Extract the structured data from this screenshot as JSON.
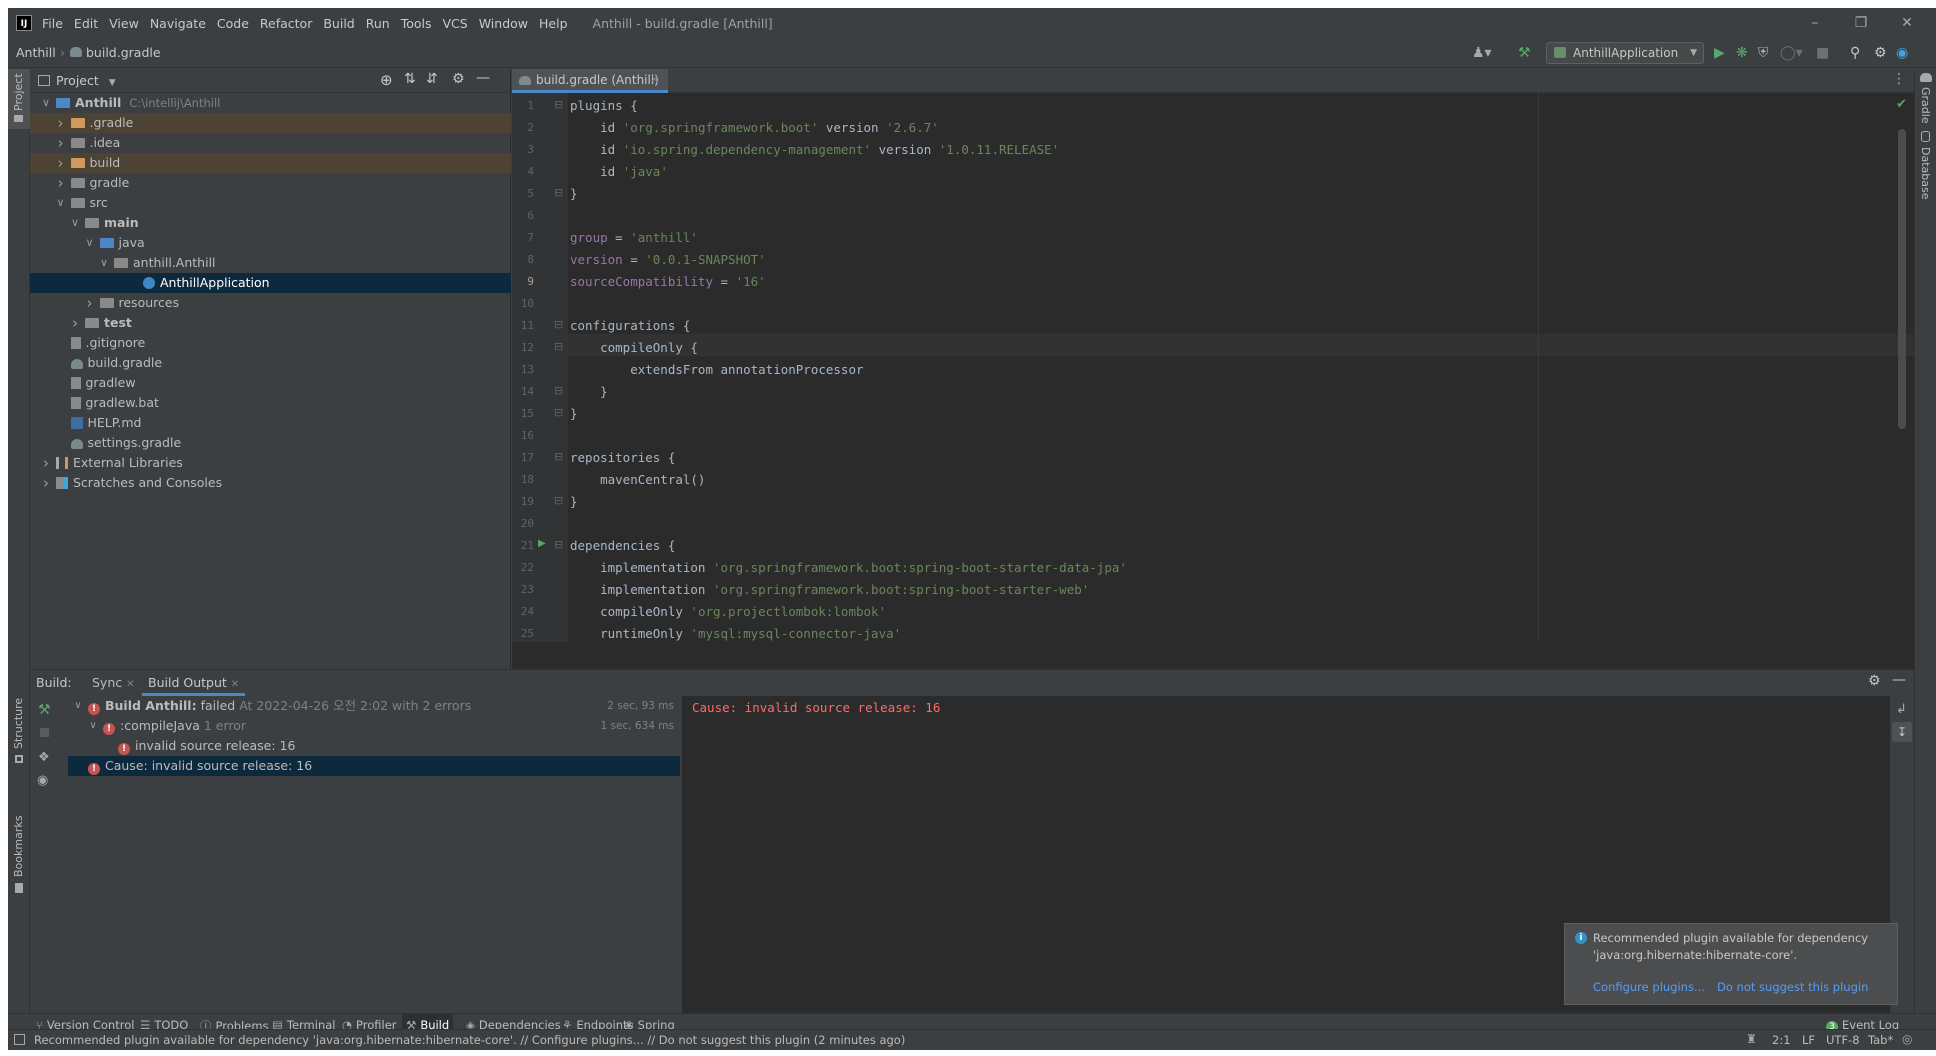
{
  "titlebar": {
    "logo": "IJ",
    "menu": [
      "File",
      "Edit",
      "View",
      "Navigate",
      "Code",
      "Refactor",
      "Build",
      "Run",
      "Tools",
      "VCS",
      "Window",
      "Help"
    ],
    "title": "Anthill - build.gradle [Anthill]"
  },
  "navbar": {
    "project": "Anthill",
    "file": "build.gradle",
    "run_config": "AnthillApplication"
  },
  "left_stripe": {
    "project": "Project",
    "structure": "Structure",
    "bookmarks": "Bookmarks"
  },
  "right_stripe": {
    "gradle": "Gradle",
    "database": "Database"
  },
  "project_panel": {
    "title": "Project",
    "tree": [
      {
        "label": "Anthill",
        "extra": "C:\\intellij\\Anthill",
        "depth": 0,
        "arrow": "down",
        "icon": "module",
        "bold": true
      },
      {
        "label": ".gradle",
        "depth": 1,
        "arrow": "right",
        "icon": "orange",
        "excluded": true
      },
      {
        "label": ".idea",
        "depth": 1,
        "arrow": "right",
        "icon": "gray"
      },
      {
        "label": "build",
        "depth": 1,
        "arrow": "right",
        "icon": "orange",
        "excluded": true
      },
      {
        "label": "gradle",
        "depth": 1,
        "arrow": "right",
        "icon": "gray"
      },
      {
        "label": "src",
        "depth": 1,
        "arrow": "down",
        "icon": "gray"
      },
      {
        "label": "main",
        "depth": 2,
        "arrow": "down",
        "icon": "gray",
        "bold": true
      },
      {
        "label": "java",
        "depth": 3,
        "arrow": "down",
        "icon": "blue"
      },
      {
        "label": "anthill.Anthill",
        "depth": 4,
        "arrow": "down",
        "icon": "gray"
      },
      {
        "label": "AnthillApplication",
        "depth": 6,
        "arrow": "",
        "icon": "class",
        "selected": true
      },
      {
        "label": "resources",
        "depth": 3,
        "arrow": "right",
        "icon": "gray"
      },
      {
        "label": "test",
        "depth": 2,
        "arrow": "right",
        "icon": "gray",
        "bold": true
      },
      {
        "label": ".gitignore",
        "depth": 1,
        "arrow": "",
        "icon": "file"
      },
      {
        "label": "build.gradle",
        "depth": 1,
        "arrow": "",
        "icon": "gradle"
      },
      {
        "label": "gradlew",
        "depth": 1,
        "arrow": "",
        "icon": "file"
      },
      {
        "label": "gradlew.bat",
        "depth": 1,
        "arrow": "",
        "icon": "file"
      },
      {
        "label": "HELP.md",
        "depth": 1,
        "arrow": "",
        "icon": "md"
      },
      {
        "label": "settings.gradle",
        "depth": 1,
        "arrow": "",
        "icon": "gradle"
      },
      {
        "label": "External Libraries",
        "depth": 0,
        "arrow": "right",
        "icon": "lib"
      },
      {
        "label": "Scratches and Consoles",
        "depth": 0,
        "arrow": "right",
        "icon": "scratch"
      }
    ]
  },
  "editor": {
    "tab_label": "build.gradle (Anthill)",
    "current_line": 9,
    "lines": [
      [
        {
          "t": "plugins {",
          "c": "kw"
        }
      ],
      [
        {
          "t": "    id ",
          "c": "kw"
        },
        {
          "t": "'org.springframework.boot'",
          "c": "str"
        },
        {
          "t": " version ",
          "c": "kw"
        },
        {
          "t": "'2.6.7'",
          "c": "str"
        }
      ],
      [
        {
          "t": "    id ",
          "c": "kw"
        },
        {
          "t": "'io.spring.dependency-management'",
          "c": "str"
        },
        {
          "t": " version ",
          "c": "kw"
        },
        {
          "t": "'1.0.11.RELEASE'",
          "c": "str"
        }
      ],
      [
        {
          "t": "    id ",
          "c": "kw"
        },
        {
          "t": "'java'",
          "c": "str"
        }
      ],
      [
        {
          "t": "}",
          "c": "kw"
        }
      ],
      [],
      [
        {
          "t": "group",
          "c": "prop"
        },
        {
          "t": " = ",
          "c": "kw"
        },
        {
          "t": "'anthill'",
          "c": "str"
        }
      ],
      [
        {
          "t": "version",
          "c": "prop"
        },
        {
          "t": " = ",
          "c": "kw"
        },
        {
          "t": "'0.0.1-SNAPSHOT'",
          "c": "str"
        }
      ],
      [
        {
          "t": "sourceCompatibility",
          "c": "prop"
        },
        {
          "t": " = ",
          "c": "kw"
        },
        {
          "t": "'16'",
          "c": "str"
        }
      ],
      [],
      [
        {
          "t": "configurations {",
          "c": "kw"
        }
      ],
      [
        {
          "t": "    compileOnly {",
          "c": "kw"
        }
      ],
      [
        {
          "t": "        extendsFrom annotationProcessor",
          "c": "kw"
        }
      ],
      [
        {
          "t": "    }",
          "c": "kw"
        }
      ],
      [
        {
          "t": "}",
          "c": "kw"
        }
      ],
      [],
      [
        {
          "t": "repositories {",
          "c": "kw"
        }
      ],
      [
        {
          "t": "    mavenCentral()",
          "c": "kw"
        }
      ],
      [
        {
          "t": "}",
          "c": "kw"
        }
      ],
      [],
      [
        {
          "t": "dependencies {",
          "c": "kw"
        }
      ],
      [
        {
          "t": "    implementation ",
          "c": "kw"
        },
        {
          "t": "'org.springframework.boot:spring-boot-starter-data-jpa'",
          "c": "str"
        }
      ],
      [
        {
          "t": "    implementation ",
          "c": "kw"
        },
        {
          "t": "'org.springframework.boot:spring-boot-starter-web'",
          "c": "str"
        }
      ],
      [
        {
          "t": "    compileOnly ",
          "c": "kw"
        },
        {
          "t": "'org.projectlombok:lombok'",
          "c": "str"
        }
      ],
      [
        {
          "t": "    runtimeOnly ",
          "c": "kw"
        },
        {
          "t": "'mysql:mysql-connector-java'",
          "c": "str"
        }
      ]
    ]
  },
  "build_panel": {
    "label": "Build:",
    "tabs": [
      "Sync",
      "Build Output"
    ],
    "active_tab": "Build Output",
    "rows": [
      {
        "depth": 0,
        "arrow": "down",
        "bold": "Build Anthill:",
        "text": " failed",
        "dim": " At 2022-04-26 오전 2:02 with 2 errors",
        "timing": "2 sec, 93 ms"
      },
      {
        "depth": 1,
        "arrow": "down",
        "bold": "",
        "text": ":compileJava",
        "dim": " 1 error",
        "timing": "1 sec, 634 ms"
      },
      {
        "depth": 2,
        "arrow": "",
        "bold": "",
        "text": "invalid source release: 16",
        "dim": "",
        "timing": ""
      },
      {
        "depth": 0,
        "arrow": "",
        "bold": "",
        "text": "Cause: invalid source release: 16",
        "dim": "",
        "timing": "",
        "selected": true
      }
    ],
    "console_text": "Cause: invalid source release: 16"
  },
  "notification": {
    "message_line1": "Recommended plugin available for dependency",
    "message_line2": "'java:org.hibernate:hibernate-core'.",
    "action1": "Configure plugins...",
    "action2": "Do not suggest this plugin"
  },
  "bottom_tools": [
    "Version Control",
    "TODO",
    "Problems",
    "Terminal",
    "Profiler",
    "Build",
    "Dependencies",
    "Endpoints",
    "Spring"
  ],
  "active_bottom_tool": "Build",
  "event_log": {
    "count": "3",
    "label": "Event Log"
  },
  "status": {
    "message": "Recommended plugin available for dependency 'java:org.hibernate:hibernate-core'. // Configure plugins... // Do not suggest this plugin (2 minutes ago)",
    "position": "2:1",
    "line_sep": "LF",
    "encoding": "UTF-8",
    "indent": "Tab*"
  },
  "colors": {
    "bg": "#3c3f41",
    "editor_bg": "#2b2b2b",
    "string": "#6a8759",
    "property": "#9876aa",
    "error": "#c75450",
    "link": "#589df6",
    "selection": "#0d293e"
  }
}
